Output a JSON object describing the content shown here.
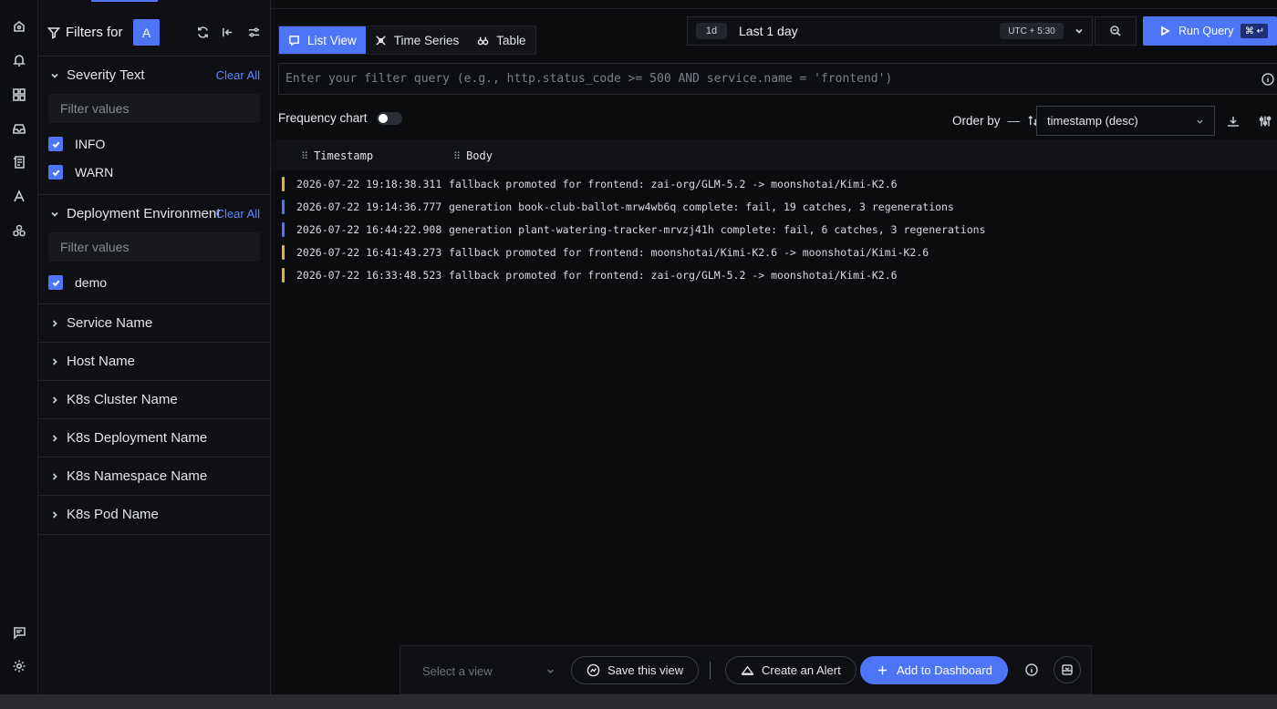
{
  "filters": {
    "title": "Filters for",
    "query_badge": "A",
    "sections": [
      {
        "label": "Severity Text",
        "clear_all": "Clear All",
        "placeholder": "Filter values",
        "values": [
          "INFO",
          "WARN"
        ]
      },
      {
        "label": "Deployment Environment",
        "clear_all": "Clear All",
        "placeholder": "Filter values",
        "values": [
          "demo"
        ]
      }
    ],
    "collapsed": [
      "Service Name",
      "Host Name",
      "K8s Cluster Name",
      "K8s Deployment Name",
      "K8s Namespace Name",
      "K8s Pod Name"
    ]
  },
  "views": {
    "tabs": [
      "List View",
      "Time Series",
      "Table"
    ],
    "active": "List View"
  },
  "time": {
    "chip": "1d",
    "label": "Last 1 day",
    "timezone": "UTC + 5:30"
  },
  "run": {
    "label": "Run Query",
    "shortcut": "⌘ ↵"
  },
  "query": {
    "placeholder": "Enter your filter query (e.g., http.status_code >= 500 AND service.name = 'frontend')"
  },
  "controls": {
    "frequency_label": "Frequency chart",
    "frequency_on": false,
    "order_label": "Order by",
    "order_dash": "—",
    "order_value": "timestamp (desc)"
  },
  "table": {
    "columns": [
      "Timestamp",
      "Body"
    ],
    "rows": [
      {
        "severity": "WARN",
        "color": "#e2b33a",
        "timestamp": "2026-07-22 19:18:38.311",
        "body": "fallback promoted for frontend: zai-org/GLM-5.2 -> moonshotai/Kimi-K2.6"
      },
      {
        "severity": "INFO",
        "color": "#4e74f8",
        "timestamp": "2026-07-22 19:14:36.777",
        "body": "generation book-club-ballot-mrw4wb6q complete: fail, 19 catches, 3 regenerations"
      },
      {
        "severity": "INFO",
        "color": "#4e74f8",
        "timestamp": "2026-07-22 16:44:22.908",
        "body": "generation plant-watering-tracker-mrvzj41h complete: fail, 6 catches, 3 regenerations"
      },
      {
        "severity": "WARN",
        "color": "#e2b33a",
        "timestamp": "2026-07-22 16:41:43.273",
        "body": "fallback promoted for frontend: moonshotai/Kimi-K2.6 -> moonshotai/Kimi-K2.6"
      },
      {
        "severity": "WARN",
        "color": "#e2b33a",
        "timestamp": "2026-07-22 16:33:48.523",
        "body": "fallback promoted for frontend: zai-org/GLM-5.2 -> moonshotai/Kimi-K2.6"
      }
    ]
  },
  "bottom": {
    "view_placeholder": "Select a view",
    "save_view": "Save this view",
    "create_alert": "Create an Alert",
    "add_dashboard": "Add to Dashboard"
  },
  "colors": {
    "accent": "#4e74f8",
    "warn": "#e2b33a",
    "info": "#4e74f8"
  }
}
